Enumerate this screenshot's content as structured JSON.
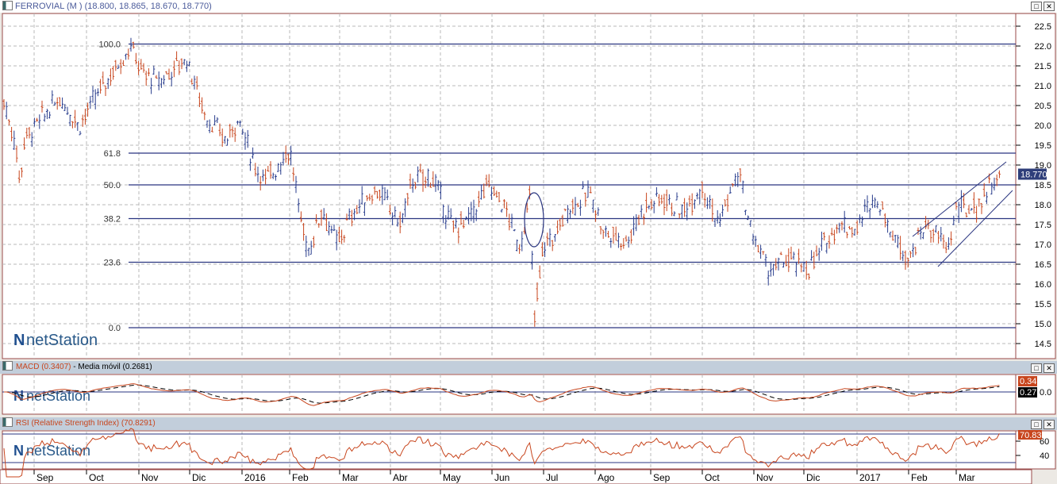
{
  "window": {
    "title": "FERROVIAL (M ) (18.800, 18.865, 18.670, 18.770)",
    "maximize": "□",
    "close": "✕"
  },
  "logo": "netStation",
  "colors": {
    "up": "#283c8c",
    "down": "#c8461e",
    "line": "#2a3580",
    "macd": "#c8461e",
    "signal": "#000000",
    "grid": "#b8b8b8",
    "frame": "#9a4a4a"
  },
  "chart_data": {
    "type": "ohlc",
    "title": "FERROVIAL (M )",
    "last": {
      "open": 18.8,
      "high": 18.865,
      "low": 18.67,
      "close": 18.77,
      "label": "18.770"
    },
    "ylim": [
      14.3,
      22.7
    ],
    "yticks": [
      "22.5",
      "22.0",
      "21.5",
      "21.0",
      "20.5",
      "20.0",
      "19.5",
      "19.0",
      "18.5",
      "18.0",
      "17.5",
      "17.0",
      "16.5",
      "16.0",
      "15.5",
      "15.0",
      "14.5"
    ],
    "xticks": [
      "Sep",
      "Oct",
      "Nov",
      "Dic",
      "2016",
      "Feb",
      "Mar",
      "Abr",
      "May",
      "Jun",
      "Jul",
      "Ago",
      "Sep",
      "Oct",
      "Nov",
      "Dic",
      "2017",
      "Feb",
      "Mar"
    ],
    "fibonacci": [
      {
        "label": "100.0",
        "price": 22.05
      },
      {
        "label": "61.8",
        "price": 19.3
      },
      {
        "label": "50.0",
        "price": 18.5
      },
      {
        "label": "38.2",
        "price": 17.65
      },
      {
        "label": "23.6",
        "price": 16.55
      },
      {
        "label": "0.0",
        "price": 14.9
      }
    ],
    "price_path_months_vs_price": [
      [
        0.03,
        20.6
      ],
      [
        0.26,
        19.5
      ],
      [
        0.34,
        18.5
      ],
      [
        0.42,
        19.6
      ],
      [
        0.65,
        20.0
      ],
      [
        1.11,
        20.7
      ],
      [
        1.49,
        20.0
      ],
      [
        1.95,
        21.0
      ],
      [
        2.49,
        22.0
      ],
      [
        2.72,
        21.3
      ],
      [
        3.03,
        21.1
      ],
      [
        3.57,
        21.7
      ],
      [
        3.95,
        20.2
      ],
      [
        4.34,
        19.6
      ],
      [
        4.57,
        20.2
      ],
      [
        4.88,
        19.0
      ],
      [
        5.11,
        18.6
      ],
      [
        5.57,
        19.4
      ],
      [
        5.8,
        17.5
      ],
      [
        5.95,
        16.8
      ],
      [
        6.18,
        17.9
      ],
      [
        6.49,
        17.0
      ],
      [
        6.8,
        17.8
      ],
      [
        7.26,
        18.4
      ],
      [
        7.72,
        17.5
      ],
      [
        7.95,
        18.6
      ],
      [
        8.34,
        18.7
      ],
      [
        8.72,
        17.4
      ],
      [
        9.03,
        17.6
      ],
      [
        9.42,
        18.5
      ],
      [
        9.72,
        18.0
      ],
      [
        10.03,
        16.9
      ],
      [
        10.23,
        18.2
      ],
      [
        10.31,
        15.0
      ],
      [
        10.49,
        17.0
      ],
      [
        10.72,
        17.2
      ],
      [
        10.95,
        17.9
      ],
      [
        11.42,
        18.3
      ],
      [
        11.65,
        17.3
      ],
      [
        12.11,
        17.1
      ],
      [
        12.42,
        17.9
      ],
      [
        12.8,
        18.2
      ],
      [
        13.18,
        17.8
      ],
      [
        13.57,
        18.5
      ],
      [
        13.88,
        17.5
      ],
      [
        14.11,
        18.3
      ],
      [
        14.29,
        18.8
      ],
      [
        14.49,
        17.4
      ],
      [
        14.88,
        16.3
      ],
      [
        15.18,
        16.6
      ],
      [
        15.65,
        16.4
      ],
      [
        16.18,
        17.5
      ],
      [
        16.57,
        17.4
      ],
      [
        16.88,
        18.2
      ],
      [
        17.11,
        17.8
      ],
      [
        17.26,
        17.2
      ],
      [
        17.57,
        16.7
      ],
      [
        17.92,
        17.5
      ],
      [
        18.34,
        16.9
      ],
      [
        18.49,
        17.9
      ],
      [
        18.88,
        17.9
      ],
      [
        19.11,
        18.4
      ],
      [
        19.37,
        18.77
      ]
    ],
    "macd": {
      "label": "MACD (0.3407)",
      "signal_label": "Media móvil (0.2681)",
      "value": "0.34",
      "signal": "0.27",
      "zero": "0.0"
    },
    "rsi": {
      "label": "RSI (Relative Strength Index) (70.8291)",
      "value": "70.83",
      "ticks": [
        "60",
        "40"
      ],
      "levels": [
        70,
        30
      ]
    }
  }
}
